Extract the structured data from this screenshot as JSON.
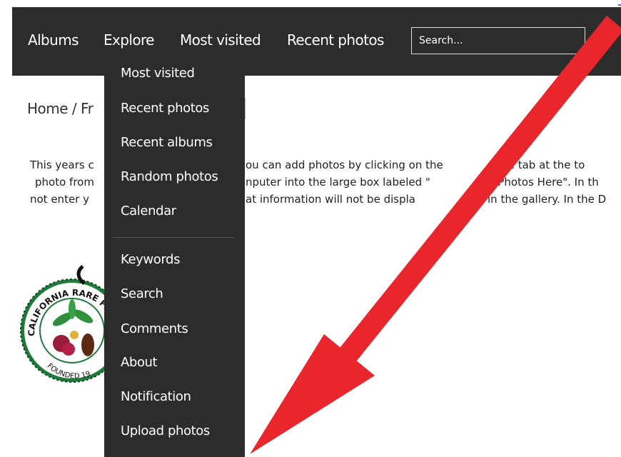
{
  "nav": {
    "items": [
      "Albums",
      "Explore",
      "Most visited",
      "Recent photos"
    ],
    "search_placeholder": "Search..."
  },
  "breadcrumb": {
    "text": "Home / Fr"
  },
  "description": {
    "lines": [
      "This years c",
      "ou can add photos by clicking on the",
      "plore tab at the to",
      "photo from",
      "nputer into the large box labeled \"",
      "g Photos Here\". In th",
      "not enter y",
      "at information will not be displa",
      "in the gallery. In the D"
    ]
  },
  "logo": {
    "arc_text": "CALIFORNIA RARE FRU",
    "bottom_text": "FOUNDED 19"
  },
  "dropdown": {
    "items": [
      "Most visited",
      "Recent photos",
      "Recent albums",
      "Random photos",
      "Calendar",
      "Keywords",
      "Search",
      "Comments",
      "About",
      "Notification",
      "Upload photos"
    ]
  },
  "colors": {
    "navbar_bg": "#2c2c2c",
    "menu_text": "#ffffff",
    "arrow": "#e8262b",
    "logo_green": "#1f7a3a"
  }
}
